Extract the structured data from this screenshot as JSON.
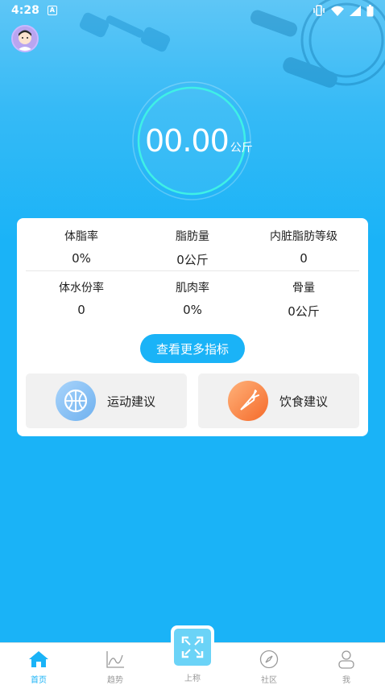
{
  "status_bar": {
    "time": "4:28",
    "notification_badge": "A"
  },
  "gauge": {
    "weight_value": "00.00",
    "weight_unit": "公斤"
  },
  "metrics": [
    {
      "label": "体脂率",
      "value": "0%"
    },
    {
      "label": "脂肪量",
      "value": "0公斤"
    },
    {
      "label": "内脏脂肪等级",
      "value": "0"
    },
    {
      "label": "体水份率",
      "value": "0"
    },
    {
      "label": "肌肉率",
      "value": "0%"
    },
    {
      "label": "骨量",
      "value": "0公斤"
    }
  ],
  "more_button_label": "查看更多指标",
  "advice": {
    "exercise_label": "运动建议",
    "diet_label": "饮食建议"
  },
  "tabbar": {
    "home": "首页",
    "trend": "趋势",
    "weigh": "上称",
    "community": "社区",
    "me": "我"
  },
  "colors": {
    "accent": "#1ab3f7",
    "gauge_ring": "#3ff0e6",
    "diet_icon": "#f7823e",
    "exercise_icon": "#8fc3f5"
  }
}
